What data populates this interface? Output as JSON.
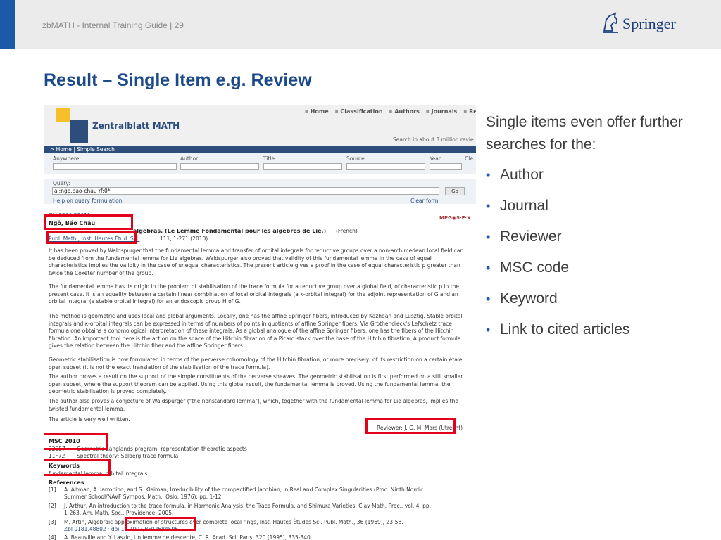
{
  "header": {
    "guide_title": "zbMATH - Internal Training Guide | 29",
    "brand": "Springer"
  },
  "slide": {
    "title": "Result – Single Item e.g. Review",
    "intro": "Single items even offer further searches for the:",
    "bullets": [
      "Author",
      "Journal",
      "Reviewer",
      "MSC code",
      "Keyword",
      "Link to cited articles"
    ]
  },
  "zb": {
    "logo_text": "Zentralblatt MATH",
    "nav": [
      "Home",
      "Classification",
      "Authors",
      "Journals",
      "Re"
    ],
    "search_info": "Search in about 3 million revie",
    "breadcrumb": "> Home | Simple Search",
    "fields": [
      "Anywhere",
      "Author",
      "Title",
      "Source",
      "Year",
      "Cle"
    ],
    "query_label": "Query:",
    "query_value": "ai:ngo.bao-chau rf:0*",
    "go_label": "Go",
    "help_link": "Help on query formulation",
    "clear_link": "Clear form"
  },
  "result": {
    "zbl_id": "Zbl 1200.22011",
    "author": "Ngô, Báo Châu",
    "title_pre": "Le lemme fondamental pour les algèbres de Lie.",
    "title_main": "algebras. (Le Lemme Fondamental pour les algèbres de Lie.)",
    "language": "(French)",
    "source": "Publ. Math., Inst. Hautes Étud. Sci.",
    "source_rest": "111, 1-271 (2010).",
    "mpg": "MPG◉S·F·X",
    "paragraphs": [
      "It has been proved by Waldspurger that the fundamental lemma and transfer of orbital integrals for reductive groups over a non-archimedean local field can be deduced from the fundamental lemma for Lie algebras. Waldspurger also proved that validity of this fundamental lemma in the case of equal characteristics implies the validity in the case of unequal characteristics. The present article gives a proof in the case of equal characteristic p greater than twice the Coxeter number of the group.",
      "The fundamental lemma has its origin in the problem of stabilisation of the trace formula for a reductive group over a global field, of characteristic p in the present case. It is an equality between a certain linear combination of local orbital integrals (a κ-orbital integral) for the adjoint representation of G and an orbital integral (a stable orbital integral) for an endoscopic group H of G.",
      "The method is geometric and uses local and global arguments. Locally, one has the affine Springer fibers, introduced by Kazhdan and Lusztig. Stable orbital integrals and κ-orbital integrals can be expressed in terms of numbers of points in quotients of affine Springer fibers. Via Grothendieck's Lefschetz trace formula one obtains a cohomological interpretation of these integrals. As a global analogue of the affine Springer fibers, one has the fibers of the Hitchin fibration. An important tool here is the action on the space of the Hitchin fibration of a Picard stack over the base of the Hitchin fibration. A product formula gives the relation between the Hitchin fiber and the affine Springer fibers.",
      "Geometric stabilisation is now formulated in terms of the perverse cohomology of the Hitchin fibration, or more precisely, of its restriction on a certain étale open subset (it is not the exact translation of the stabilisation of the trace formula).",
      "The author proves a result on the support of the simple constituents of the perverse sheaves. The geometric stabilisation is first performed on a still smaller open subset, where the support theorem can be applied. Using this global result, the fundamental lemma is proved. Using the fundamental lemma, the geometric stabilisation is proved completely.",
      "The author also proves a conjecture of Waldspurger (\"the nonstandard lemma\"), which, together with the fundamental lemma for Lie algebras, implies the twisted fundamental lemma.",
      "The article is very well written."
    ],
    "reviewer": "Reviewer: J. G. M. Mars (Utrecht)",
    "msc_heading": "MSC 2010",
    "msc": [
      {
        "code": "22E57",
        "label": "Geometric Langlands program: representation-theoretic aspects"
      },
      {
        "code": "11F72",
        "label": "Spectral theory; Selberg trace formula"
      }
    ],
    "keywords_heading": "Keywords",
    "keywords": "fundamental lemma; orbital integrals",
    "references_heading": "References",
    "references": [
      {
        "n": "[1]",
        "l1": "A. Altman, A. Iarrobino, and S. Kleiman, Irreducibility of the compactified Jacobian, in Real and Complex Singularities (Proc. Ninth Nordic",
        "l2": "Summer School/NAVF Sympos. Math., Oslo, 1976), pp. 1-12."
      },
      {
        "n": "[2]",
        "l1": "J. Arthur, An introduction to the trace formula, in Harmonic Analysis, the Trace Formula, and Shimura Varieties. Clay Math. Proc., vol. 4, pp.",
        "l2": "1-263, Am. Math. Soc., Providence, 2005."
      },
      {
        "n": "[3]",
        "l1": "M. Artin, Algebraic approximation of structures over complete local rings, Inst. Hautes Études Sci. Publ. Math., 36 (1969), 23-58. ·",
        "l2": "Zbl 0181.48802 · doi:10.1007/BF02684596"
      },
      {
        "n": "[4]",
        "l1": "A. Beauville and Y. Laszlo, Un lemme de descente, C. R. Acad. Sci. Paris, 320 (1995), 335-340.",
        "l2": ""
      }
    ]
  }
}
